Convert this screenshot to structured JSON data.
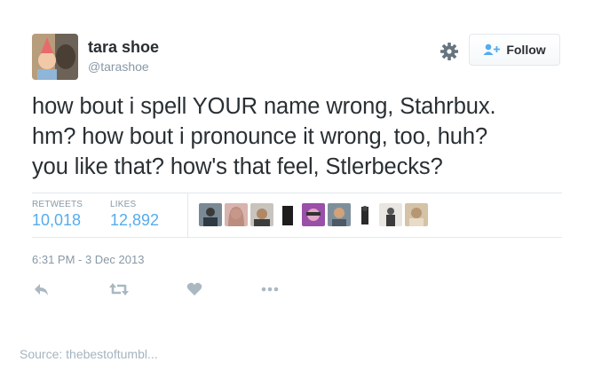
{
  "user": {
    "name": "tara shoe",
    "handle": "@tarashoe"
  },
  "follow_button": {
    "label": "Follow",
    "icon": "follow-user-plus-icon"
  },
  "settings_icon": "gear-icon",
  "tweet": {
    "text": "how bout i spell YOUR name wrong, Stahrbux.\nhm? how bout i pronounce it wrong, too, huh?\nyou like that? how's that feel, Stlerbecks?"
  },
  "stats": {
    "retweets_label": "RETWEETS",
    "retweets_value": "10,018",
    "likes_label": "LIKES",
    "likes_value": "12,892"
  },
  "likers_count_shown": 9,
  "timestamp": "6:31 PM - 3 Dec 2013",
  "actions": [
    "reply-icon",
    "retweet-icon",
    "like-heart-icon",
    "more-icon"
  ],
  "colors": {
    "accent": "#55acee",
    "muted": "#8899a6",
    "text": "#292f33",
    "border": "#e1e8ed"
  },
  "source": "Source: thebestoftumbl..."
}
